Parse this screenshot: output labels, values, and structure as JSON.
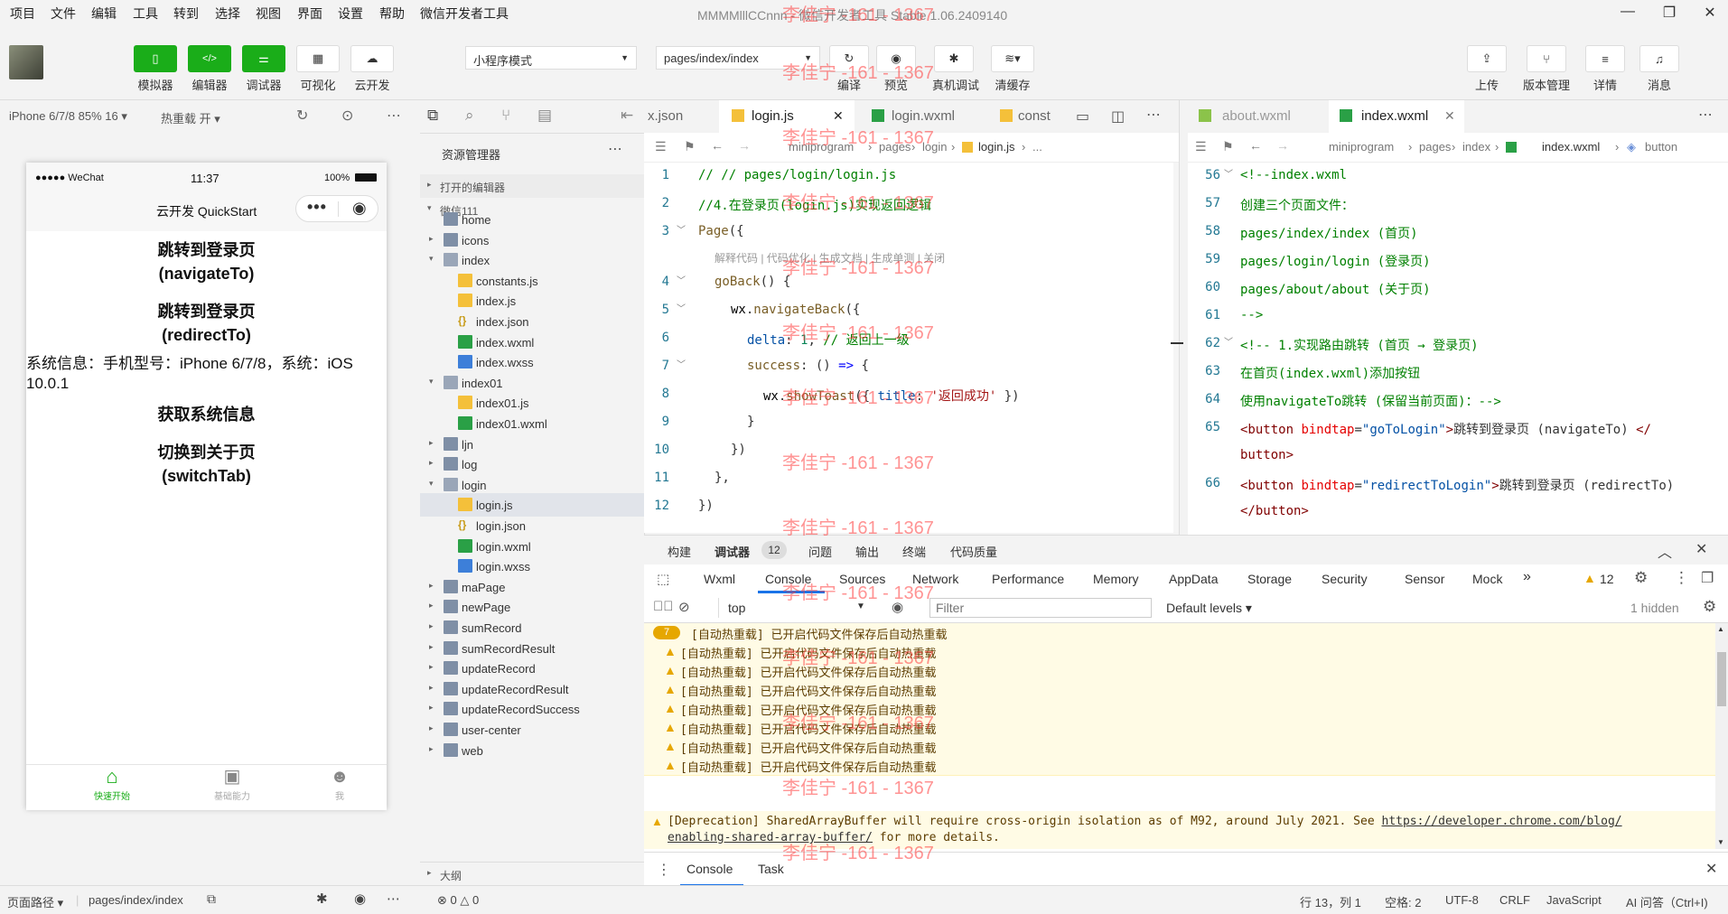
{
  "menubar": {
    "items": [
      "项目",
      "文件",
      "编辑",
      "工具",
      "转到",
      "选择",
      "视图",
      "界面",
      "设置",
      "帮助",
      "微信开发者工具"
    ],
    "title": "MMMMlllCCnnn - 微信开发者工具 Stable 1.06.2409140"
  },
  "toolbar": {
    "left_buttons": [
      "模拟器",
      "编辑器",
      "调试器",
      "可视化",
      "云开发"
    ],
    "mode_select": "小程序模式",
    "page_select": "pages/index/index",
    "mid_buttons": [
      "编译",
      "预览",
      "真机调试",
      "清缓存"
    ],
    "right_buttons": [
      "上传",
      "版本管理",
      "详情",
      "消息"
    ]
  },
  "simulator": {
    "device": "iPhone 6/7/8 85% 16",
    "hot_reload": "热重载 开",
    "status_carrier": "●●●●● WeChat",
    "status_time": "11:37",
    "status_battery": "100%",
    "nav_title": "云开发 QuickStart",
    "btn1_line1": "跳转到登录页",
    "btn1_line2": "(navigateTo)",
    "btn2_line1": "跳转到登录页",
    "btn2_line2": "(redirectTo)",
    "sysinfo_line1": "系统信息：手机型号：iPhone 6/7/8，系统：iOS",
    "sysinfo_line2": "10.0.1",
    "btn3": "获取系统信息",
    "btn4_line1": "切换到关于页",
    "btn4_line2": "(switchTab)",
    "tabbar": [
      "快速开始",
      "基础能力",
      "我"
    ]
  },
  "explorer": {
    "title": "资源管理器",
    "section_open": "打开的编辑器",
    "project": "微信111",
    "outline": "大纲",
    "tree": [
      {
        "name": "home",
        "type": "folder",
        "depth": 1,
        "arrow": "",
        "partial": true
      },
      {
        "name": "icons",
        "type": "folder",
        "depth": 1,
        "arrow": "▸"
      },
      {
        "name": "index",
        "type": "folder-open",
        "depth": 1,
        "arrow": "▾"
      },
      {
        "name": "constants.js",
        "type": "js",
        "depth": 2
      },
      {
        "name": "index.js",
        "type": "js",
        "depth": 2
      },
      {
        "name": "index.json",
        "type": "json",
        "depth": 2
      },
      {
        "name": "index.wxml",
        "type": "wxml",
        "depth": 2
      },
      {
        "name": "index.wxss",
        "type": "wxss",
        "depth": 2
      },
      {
        "name": "index01",
        "type": "folder-open",
        "depth": 1,
        "arrow": "▾"
      },
      {
        "name": "index01.js",
        "type": "js",
        "depth": 2
      },
      {
        "name": "index01.wxml",
        "type": "wxml",
        "depth": 2
      },
      {
        "name": "ljn",
        "type": "folder",
        "depth": 1,
        "arrow": "▸"
      },
      {
        "name": "log",
        "type": "folder",
        "depth": 1,
        "arrow": "▸"
      },
      {
        "name": "login",
        "type": "folder-open",
        "depth": 1,
        "arrow": "▾"
      },
      {
        "name": "login.js",
        "type": "js",
        "depth": 2,
        "selected": true
      },
      {
        "name": "login.json",
        "type": "json",
        "depth": 2
      },
      {
        "name": "login.wxml",
        "type": "wxml",
        "depth": 2
      },
      {
        "name": "login.wxss",
        "type": "wxss",
        "depth": 2
      },
      {
        "name": "maPage",
        "type": "folder",
        "depth": 1,
        "arrow": "▸"
      },
      {
        "name": "newPage",
        "type": "folder",
        "depth": 1,
        "arrow": "▸"
      },
      {
        "name": "sumRecord",
        "type": "folder",
        "depth": 1,
        "arrow": "▸"
      },
      {
        "name": "sumRecordResult",
        "type": "folder",
        "depth": 1,
        "arrow": "▸"
      },
      {
        "name": "updateRecord",
        "type": "folder",
        "depth": 1,
        "arrow": "▸"
      },
      {
        "name": "updateRecordResult",
        "type": "folder",
        "depth": 1,
        "arrow": "▸"
      },
      {
        "name": "updateRecordSuccess",
        "type": "folder",
        "depth": 1,
        "arrow": "▸"
      },
      {
        "name": "user-center",
        "type": "folder",
        "depth": 1,
        "arrow": "▸"
      },
      {
        "name": "web",
        "type": "folder",
        "depth": 1,
        "arrow": "▸",
        "partial": true
      }
    ]
  },
  "editor1": {
    "tabs": [
      "x.json",
      "login.js",
      "login.wxml",
      "const"
    ],
    "crumbs": [
      "miniprogram",
      "pages",
      "login",
      "login.js",
      "..."
    ],
    "codelens": "解释代码 | 代码优化 | 生成文档 | 生成单测 | 关闭"
  },
  "editor2": {
    "tabs": [
      "about.wxml",
      "index.wxml"
    ],
    "crumbs": [
      "miniprogram",
      "pages",
      "index",
      "index.wxml",
      "button"
    ]
  },
  "console": {
    "top_tabs": [
      "构建",
      "调试器",
      "问题",
      "输出",
      "终端",
      "代码质量"
    ],
    "debugger_badge": "12",
    "dev_tabs": [
      "Wxml",
      "Console",
      "Sources",
      "Network",
      "Performance",
      "Memory",
      "AppData",
      "Storage",
      "Security",
      "Sensor",
      "Mock"
    ],
    "warn_count": "12",
    "context": "top",
    "filter_placeholder": "Filter",
    "levels": "Default levels",
    "hidden": "1 hidden",
    "group_badge": "7",
    "warn_msg": "[自动热重载] 已开启代码文件保存后自动热重载",
    "deprecation_line1": "[Deprecation] SharedArrayBuffer will require cross-origin isolation as of M92, around July 2021. See ",
    "deprecation_link1": "https://developer.chrome.com/blog/",
    "deprecation_link2": "enabling-shared-array-buffer/",
    "deprecation_line2": " for more details.",
    "bottom_tabs": [
      "Console",
      "Task"
    ]
  },
  "statusbar": {
    "page_path_label": "页面路径",
    "page_path": "pages/index/index",
    "errors": "0",
    "warnings": "0",
    "position": "行 13，列 1",
    "spaces": "空格: 2",
    "encoding": "UTF-8",
    "eol": "CRLF",
    "language": "JavaScript",
    "ai": "AI 问答（Ctrl+I)"
  },
  "watermark": "李佳宁 -161 - 1367",
  "colors": {
    "green": "#1aad19",
    "accent": "#1a73e8",
    "warn_bg": "#fffbe5"
  }
}
